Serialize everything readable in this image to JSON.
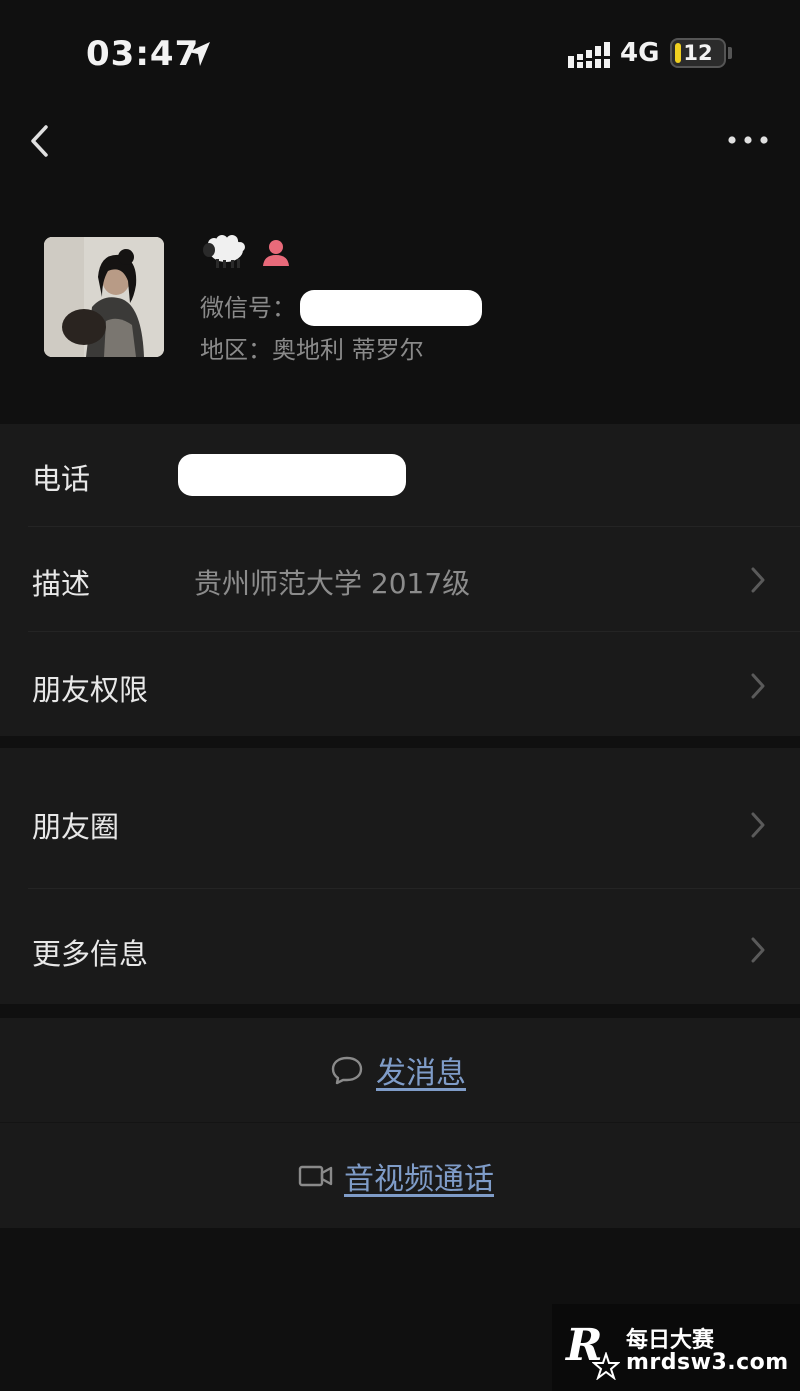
{
  "status_bar": {
    "time": "03:47",
    "network": "4G",
    "battery": "12",
    "battery_color": "#f0d020"
  },
  "nav": {
    "back_icon": "chevron-left-icon",
    "more_icon": "more-dots-icon"
  },
  "profile": {
    "nickname_icon": "sheep-emoji",
    "gender_icon": "female-icon",
    "wechat_id_label": "微信号：",
    "region_line": "地区：奥地利 蒂罗尔"
  },
  "info": {
    "phone_label": "电话",
    "description_label": "描述",
    "description_value": "贵州师范大学 2017级",
    "permissions_label": "朋友权限"
  },
  "more": {
    "moments_label": "朋友圈",
    "more_info_label": "更多信息"
  },
  "actions": {
    "message_label": "发消息",
    "call_label": "音视频通话",
    "link_color": "#7f9cc8"
  },
  "watermark": {
    "line1": "每日大赛",
    "line2": "mrdsw3.com"
  }
}
